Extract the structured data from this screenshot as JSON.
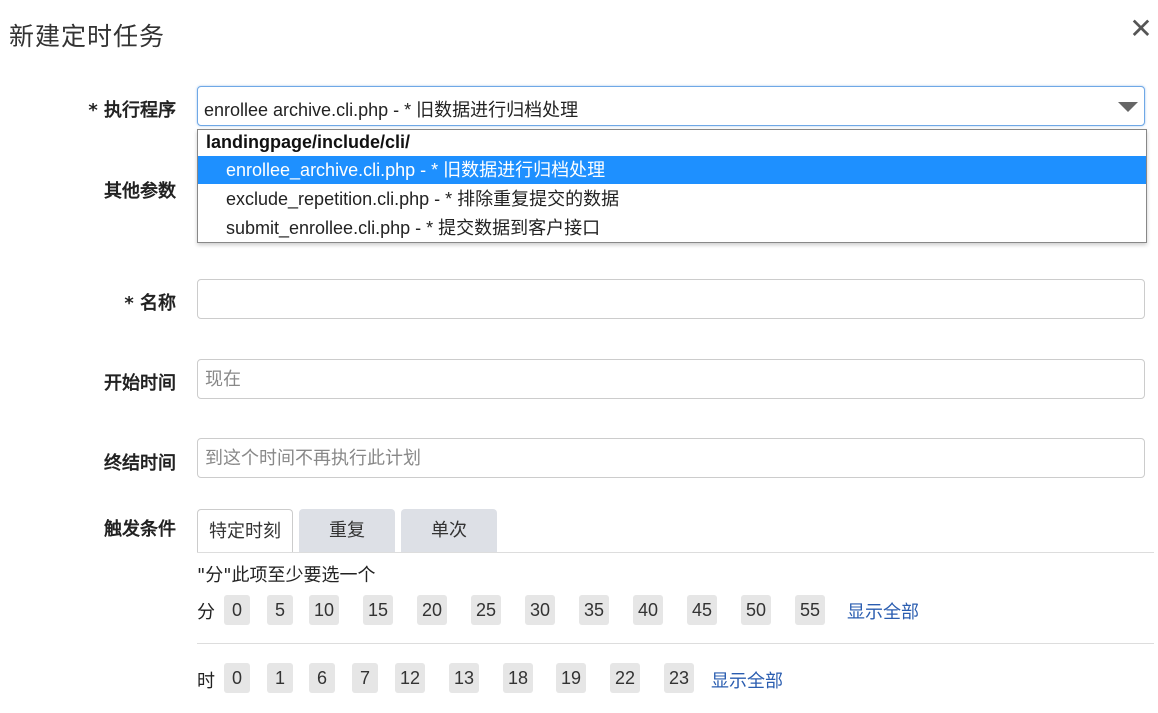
{
  "dialog": {
    "title": "新建定时任务",
    "close_glyph": "✕"
  },
  "form": {
    "program_label": "* 执行程序",
    "params_label": "其他参数",
    "name_label": "* 名称",
    "start_label": "开始时间",
    "end_label": "终结时间",
    "trigger_label": "触发条件",
    "program_value": "enrollee  archive.cli.php - * 旧数据进行归档处理",
    "name_value": "",
    "start_placeholder": "现在",
    "end_placeholder": "到这个时间不再执行此计划"
  },
  "dropdown": {
    "group": "landingpage/include/cli/",
    "options": [
      {
        "file": "enrollee_archive.cli.php",
        "desc": " - * 旧数据进行归档处理"
      },
      {
        "file": "exclude_repetition.cli.php",
        "desc": " - * 排除重复提交的数据"
      },
      {
        "file": "submit_enrollee.cli.php",
        "desc": " - * 提交数据到客户接口"
      }
    ]
  },
  "tabs": [
    "特定时刻",
    "重复",
    "单次"
  ],
  "trigger": {
    "hint": "\"分\"此项至少要选一个",
    "minute_label": "分",
    "minutes": [
      "0",
      "5",
      "10",
      "15",
      "20",
      "25",
      "30",
      "35",
      "40",
      "45",
      "50",
      "55"
    ],
    "hour_label": "时",
    "hours": [
      "0",
      "1",
      "6",
      "7",
      "12",
      "13",
      "18",
      "19",
      "22",
      "23"
    ],
    "show_all": "显示全部"
  },
  "colors": {
    "selected": "#1e90ff",
    "link": "#2a5db0"
  }
}
